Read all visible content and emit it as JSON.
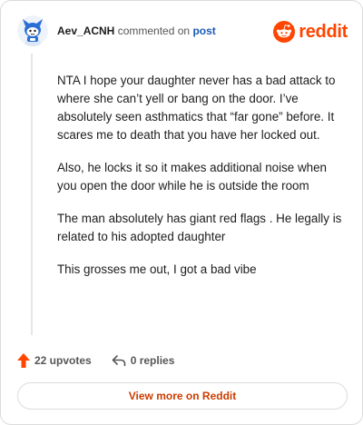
{
  "header": {
    "username": "Aev_ACNH",
    "action_text": "commented on",
    "post_link_label": "post",
    "brand_name": "reddit"
  },
  "comment": {
    "paragraphs": [
      "NTA I hope your daughter never has a bad attack to where she can’t yell or bang on the door. I’ve absolutely seen asthmatics that “far gone” before. It scares me to death that you have her locked out.",
      "Also, he locks it so it makes additional noise when you open the door while he is outside the room",
      "The man absolutely has giant red flags . He legally is related to his adopted daughter",
      "This grosses me out, I got a bad vibe"
    ]
  },
  "actions": {
    "upvotes_label": "22 upvotes",
    "replies_label": "0 replies"
  },
  "footer": {
    "view_more_label": "View more on Reddit"
  },
  "icons": {
    "avatar": "snoo-avatar-icon",
    "brand": "reddit-logo-icon",
    "upvote": "upvote-arrow-icon",
    "reply": "reply-arrow-icon"
  },
  "colors": {
    "brand": "#ff4500",
    "upvote": "#ff4500",
    "link": "#1a5bb5",
    "view_more": "#cc3d00",
    "avatar_blue": "#2b6fd6"
  }
}
